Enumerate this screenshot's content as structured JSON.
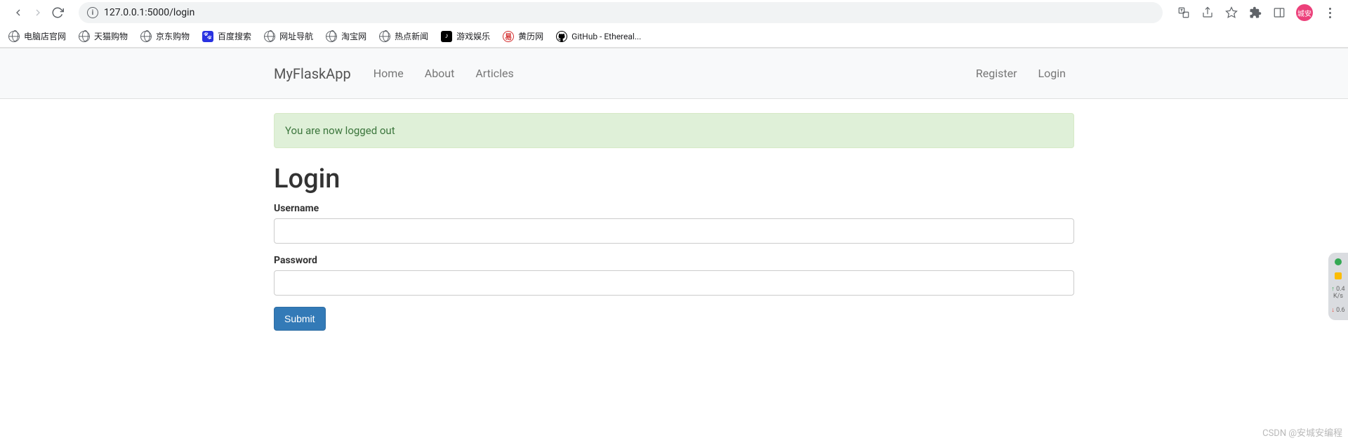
{
  "browser": {
    "url": "127.0.0.1:5000/login",
    "avatar_text": "城安"
  },
  "bookmarks": [
    {
      "label": "电脑店官网",
      "icon": "globe"
    },
    {
      "label": "天猫购物",
      "icon": "globe"
    },
    {
      "label": "京东购物",
      "icon": "globe"
    },
    {
      "label": "百度搜索",
      "icon": "baidu"
    },
    {
      "label": "网址导航",
      "icon": "globe"
    },
    {
      "label": "淘宝网",
      "icon": "globe"
    },
    {
      "label": "热点新闻",
      "icon": "globe"
    },
    {
      "label": "游戏娱乐",
      "icon": "tiktok"
    },
    {
      "label": "黄历网",
      "icon": "yi"
    },
    {
      "label": "GitHub - Ethereal...",
      "icon": "github"
    }
  ],
  "navbar": {
    "brand": "MyFlaskApp",
    "left": [
      "Home",
      "About",
      "Articles"
    ],
    "right": [
      "Register",
      "Login"
    ]
  },
  "alert": {
    "message": "You are now logged out"
  },
  "page": {
    "heading": "Login",
    "username_label": "Username",
    "password_label": "Password",
    "submit_label": "Submit"
  },
  "side_widget": {
    "up": "0.4",
    "up_unit": "K/s",
    "down": "0.6"
  },
  "watermark": "CSDN @安城安编程"
}
